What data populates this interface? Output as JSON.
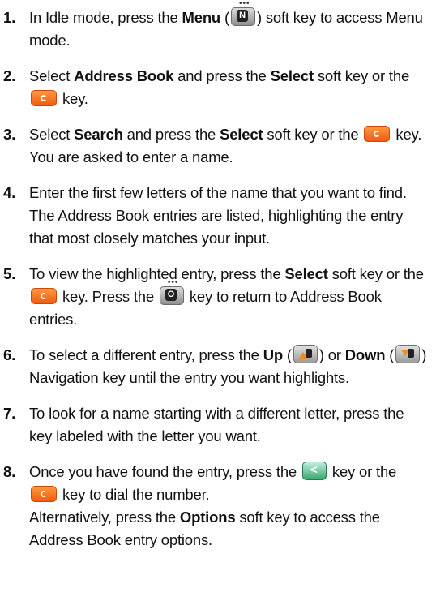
{
  "steps": [
    {
      "num": "1.",
      "t1": "In Idle mode, press the ",
      "b1": "Menu",
      "t2": " (",
      "t3": ") soft key to access Menu mode."
    },
    {
      "num": "2.",
      "t1": "Select ",
      "b1": "Address Book",
      "t2": " and press the ",
      "b2": "Select",
      "t3": " soft key or the ",
      "t4": " key."
    },
    {
      "num": "3.",
      "t1": "Select ",
      "b1": "Search",
      "t2": " and press the ",
      "b2": "Select",
      "t3": " soft key or the ",
      "t4": " key. You are asked to enter a name."
    },
    {
      "num": "4.",
      "t1": "Enter the first few letters of the name that you want to find.",
      "t2": "The Address Book entries are listed, highlighting the entry that most closely matches your input."
    },
    {
      "num": "5.",
      "t1": "To view the highlighted entry, press the ",
      "b1": "Select",
      "t2": " soft key or the ",
      "t3": " key. Press the ",
      "t4": " key to return to Address Book entries."
    },
    {
      "num": "6.",
      "t1": "To select a different entry, press the ",
      "b1": "Up",
      "t2": " (",
      "t3": ") or ",
      "b2": "Down",
      "t4": " (",
      "t5": ") Navigation key until the entry you want highlights."
    },
    {
      "num": "7.",
      "t1": "To look for a name starting with a different letter, press the key labeled with the letter you want."
    },
    {
      "num": "8.",
      "t1": "Once you have found the entry, press the ",
      "t2": " key or the ",
      "t3": " key to dial the number.",
      "t4": "Alternatively, press the ",
      "b1": "Options",
      "t5": " soft key to access the Address Book entry options."
    }
  ],
  "icons": {
    "menu_key": "menu-key-icon",
    "ok_key": "ok-key-icon",
    "back_key": "back-key-icon",
    "up_key": "nav-up-key-icon",
    "down_key": "nav-down-key-icon",
    "send_key": "send-key-icon"
  },
  "colors": {
    "ok_key": "#f05a14",
    "send_key": "#3aa86e"
  }
}
